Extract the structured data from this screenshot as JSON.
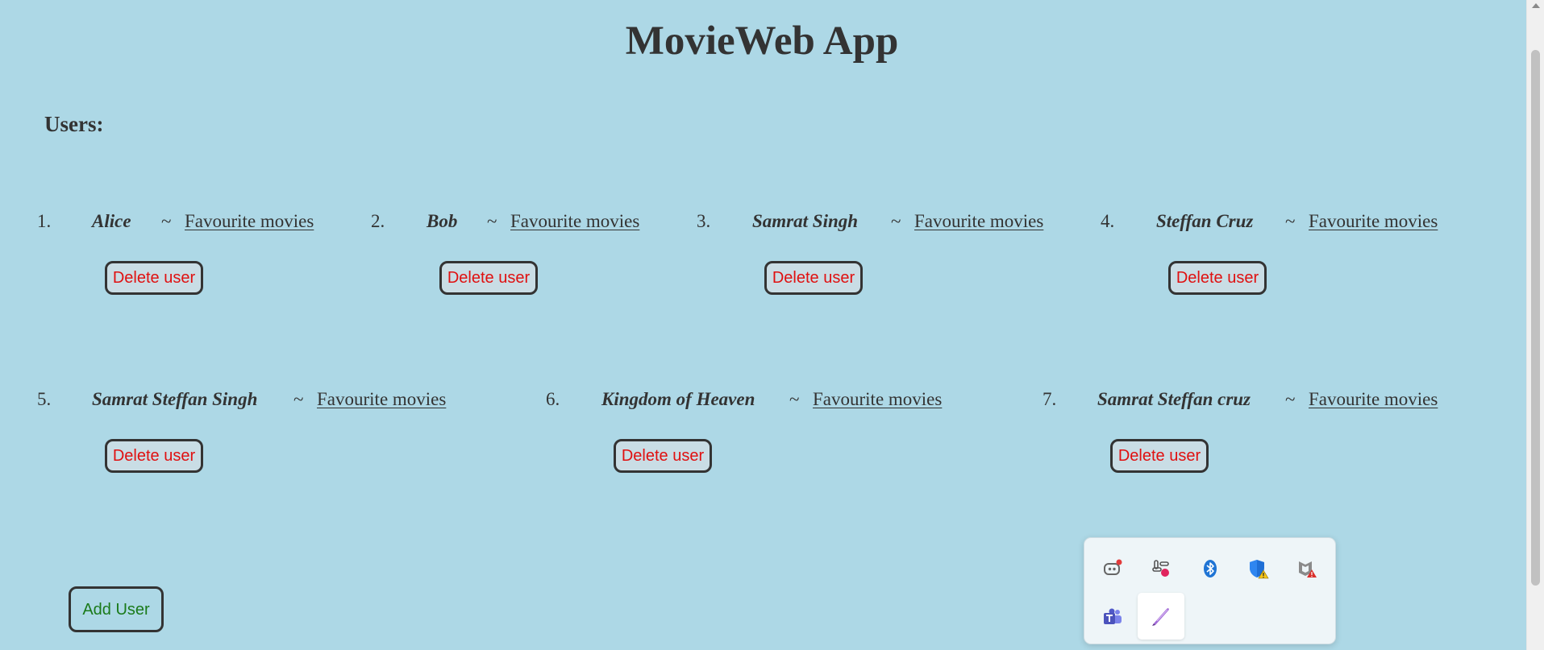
{
  "page": {
    "title": "MovieWeb App",
    "users_heading": "Users:",
    "add_user_label": "Add User"
  },
  "users": [
    {
      "number": "1.",
      "name": "Alice",
      "separator": "~",
      "link": "Favourite movies",
      "delete_label": "Delete user"
    },
    {
      "number": "2.",
      "name": "Bob",
      "separator": "~",
      "link": "Favourite movies",
      "delete_label": "Delete user"
    },
    {
      "number": "3.",
      "name": "Samrat Singh",
      "separator": "~",
      "link": "Favourite movies",
      "delete_label": "Delete user"
    },
    {
      "number": "4.",
      "name": "Steffan Cruz",
      "separator": "~",
      "link": "Favourite movies",
      "delete_label": "Delete user"
    },
    {
      "number": "5.",
      "name": "Samrat Steffan Singh",
      "separator": "~",
      "link": "Favourite movies",
      "delete_label": "Delete user"
    },
    {
      "number": "6.",
      "name": "Kingdom of Heaven",
      "separator": "~",
      "link": "Favourite movies",
      "delete_label": "Delete user"
    },
    {
      "number": "7.",
      "name": "Samrat Steffan cruz",
      "separator": "~",
      "link": "Favourite movies",
      "delete_label": "Delete user"
    }
  ],
  "tray": {
    "icons": [
      "discord-icon",
      "slack-icon",
      "bluetooth-icon",
      "windows-security-icon",
      "mcafee-icon",
      "teams-icon",
      "pen-icon"
    ]
  },
  "colors": {
    "background": "#add8e6",
    "text": "#333333",
    "delete_text": "#e01010",
    "add_text": "#1a7a1a"
  }
}
